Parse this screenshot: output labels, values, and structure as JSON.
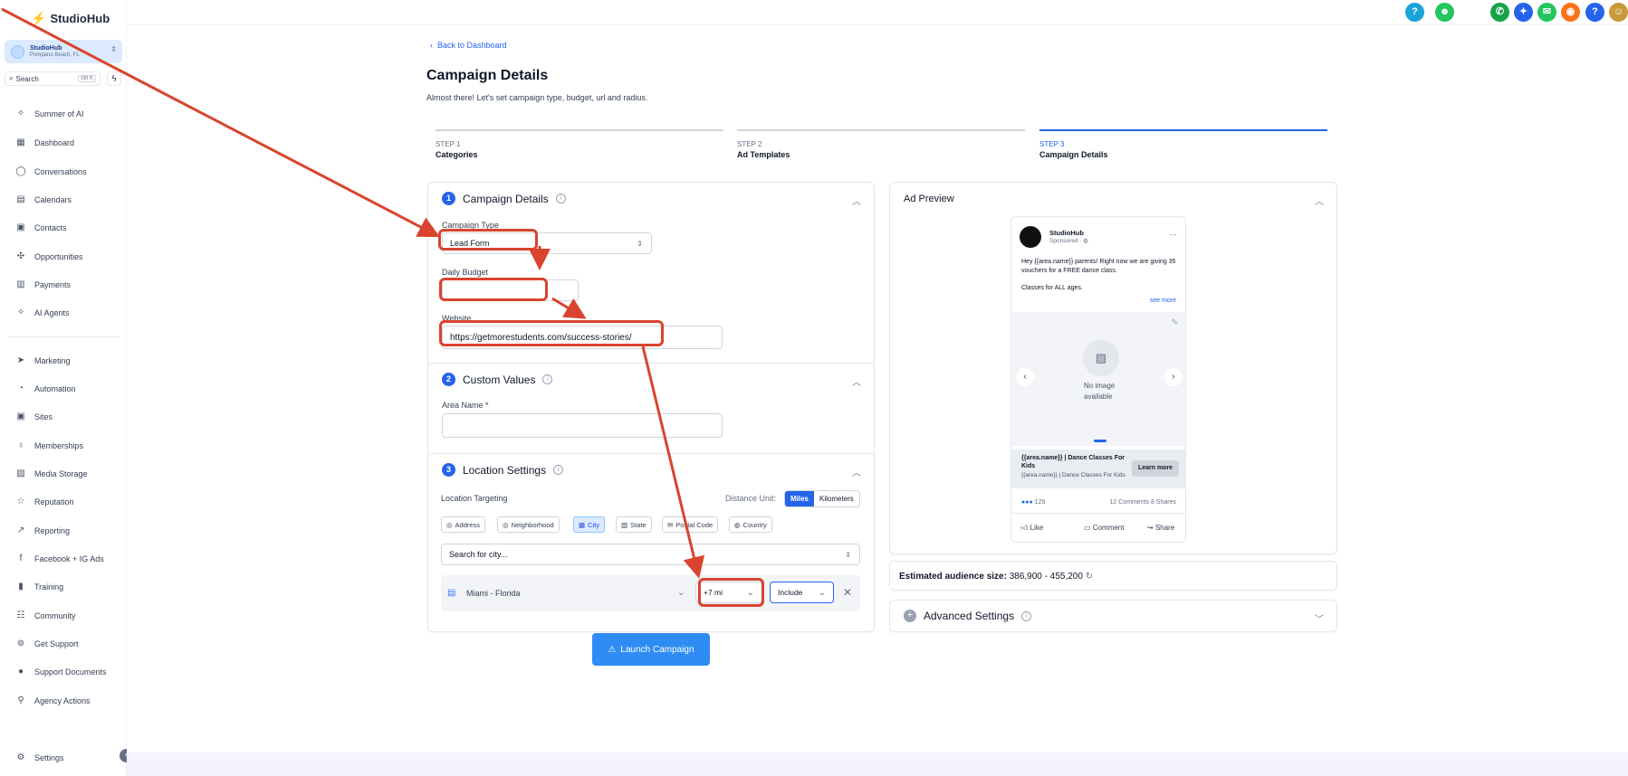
{
  "brand": {
    "name": "StudioHub"
  },
  "account": {
    "name": "StudioHub",
    "location": "Pompano Beach, FL"
  },
  "search": {
    "placeholder": "Search",
    "shortcut": "ctrl K"
  },
  "nav": {
    "top": [
      "Summer of AI",
      "Dashboard",
      "Conversations",
      "Calendars",
      "Contacts",
      "Opportunities",
      "Payments",
      "AI Agents"
    ],
    "bottom": [
      "Marketing",
      "Automation",
      "Sites",
      "Memberships",
      "Media Storage",
      "Reputation",
      "Reporting",
      "Facebook + IG Ads",
      "Training",
      "Community",
      "Get Support",
      "Support Documents",
      "Agency Actions"
    ],
    "settings": "Settings"
  },
  "topbar": {
    "icons": [
      {
        "name": "help-icon",
        "color": "#1aa3d9",
        "glyph": "?"
      },
      {
        "name": "android-icon",
        "color": "#22c55e",
        "glyph": "☻"
      },
      {
        "name": "phone-icon",
        "color": "#16a34a",
        "glyph": "✆"
      },
      {
        "name": "sparkle-icon",
        "color": "#2563eb",
        "glyph": "✦"
      },
      {
        "name": "megaphone-icon",
        "color": "#22c55e",
        "glyph": "✉"
      },
      {
        "name": "bell-icon",
        "color": "#f97316",
        "glyph": "◉"
      },
      {
        "name": "question-icon",
        "color": "#2563eb",
        "glyph": "?"
      },
      {
        "name": "avatar-icon",
        "color": "#c99a3b",
        "glyph": "☺"
      }
    ]
  },
  "page": {
    "back": "Back to Dashboard",
    "title": "Campaign Details",
    "subtitle": "Almost there! Let's set campaign type, budget, url and radius.",
    "steps": [
      {
        "num": "STEP 1",
        "label": "Categories"
      },
      {
        "num": "STEP 2",
        "label": "Ad Templates"
      },
      {
        "num": "STEP 3",
        "label": "Campaign Details"
      }
    ]
  },
  "campaign": {
    "num": "1",
    "title": "Campaign Details",
    "type_label": "Campaign Type",
    "type_value": "Lead Form",
    "budget_label": "Daily Budget",
    "budget_value": "",
    "website_label": "Website",
    "website_value": "https://getmorestudents.com/success-stories/"
  },
  "custom": {
    "num": "2",
    "title": "Custom Values",
    "area_label": "Area Name *",
    "area_value": ""
  },
  "location": {
    "num": "3",
    "title": "Location Settings",
    "targeting_label": "Location Targeting",
    "unit_label": "Distance Unit:",
    "units": [
      "Miles",
      "Kilometers"
    ],
    "chips": [
      "Address",
      "Neighborhood",
      "City",
      "State",
      "Postal Code",
      "Country"
    ],
    "city_placeholder": "Search for city...",
    "city": "Miami - Florida",
    "radius": "+7 mi",
    "include": "Include"
  },
  "launch": "Launch Campaign",
  "preview": {
    "title": "Ad Preview",
    "page_name": "StudioHub",
    "sponsored": "Sponsored ·",
    "text1": "Hey {{area.name}} parents! Right now we are giving 35 vouchers for a FREE dance class.",
    "text2": "Classes for ALL ages.",
    "see_more": "see more",
    "no_image": "No image available",
    "headline": "{{area.name}} | Dance Classes For Kids",
    "desc": "{{area.name}} | Dance Classes For Kids",
    "cta": "Learn more",
    "reactions": "129",
    "stats": "12 Comments 8 Shares",
    "actions": [
      "Like",
      "Comment",
      "Share"
    ]
  },
  "audience": {
    "label": "Estimated audience size:",
    "value": "386,900 - 455,200"
  },
  "advanced": {
    "title": "Advanced Settings"
  }
}
